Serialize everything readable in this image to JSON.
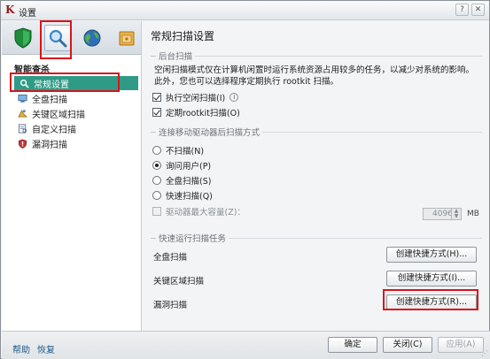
{
  "window": {
    "title": "设置",
    "controls": {
      "help": "?",
      "close": "✕"
    }
  },
  "toolbar": {
    "tabs": [
      {
        "icon": "shield-icon",
        "color": "#1f8b3b"
      },
      {
        "icon": "magnifier-icon",
        "color": "#3b88c8",
        "selected": true
      },
      {
        "icon": "globe-icon",
        "color": "#2f6fb5"
      },
      {
        "icon": "safe-icon",
        "color": "#c88a25"
      }
    ]
  },
  "sidebar": {
    "section_title": "智能查杀",
    "items": [
      {
        "label": "常规设置",
        "icon": "magnifier-icon",
        "active": true
      },
      {
        "label": "全盘扫描",
        "icon": "computer-icon"
      },
      {
        "label": "关键区域扫描",
        "icon": "key-area-icon"
      },
      {
        "label": "自定义扫描",
        "icon": "custom-scan-icon"
      },
      {
        "label": "漏洞扫描",
        "icon": "vulnerability-icon"
      }
    ]
  },
  "main": {
    "title": "常规扫描设置",
    "background_group": {
      "header": "后台扫描",
      "description": "空闲扫描模式仅在计算机闲置时运行系统资源占用较多的任务，以减少对系统的影响。此外，您也可以选择程序定期执行 rootkit 扫描。",
      "idle_scan": {
        "label": "执行空闲扫描(I)",
        "checked": true
      },
      "rootkit_scan": {
        "label": "定期rootkit扫描(O)",
        "checked": true
      }
    },
    "removable_group": {
      "header": "连接移动驱动器后扫描方式",
      "options": [
        {
          "label": "不扫描(N)",
          "checked": false
        },
        {
          "label": "询问用户(P)",
          "checked": true
        },
        {
          "label": "全盘扫描(S)",
          "checked": false
        },
        {
          "label": "快速扫描(Q)",
          "checked": false
        }
      ],
      "max_size": {
        "label": "驱动器最大容量(Z)：",
        "value": "4096",
        "unit": "MB",
        "checked": false
      }
    },
    "quick_group": {
      "header": "快速运行扫描任务",
      "tasks": [
        {
          "label": "全盘扫描",
          "button": "创建快捷方式(H)..."
        },
        {
          "label": "关键区域扫描",
          "button": "创建快捷方式(I)..."
        },
        {
          "label": "漏洞扫描",
          "button": "创建快捷方式(R)..."
        }
      ]
    }
  },
  "footer": {
    "help": "帮助",
    "restore": "恢复",
    "ok": "确定",
    "close": "关闭(C)",
    "apply": "应用(A)"
  },
  "colors": {
    "accent": "#2f9b86",
    "highlight_box": "#d8141b",
    "link": "#1a5a8a"
  }
}
